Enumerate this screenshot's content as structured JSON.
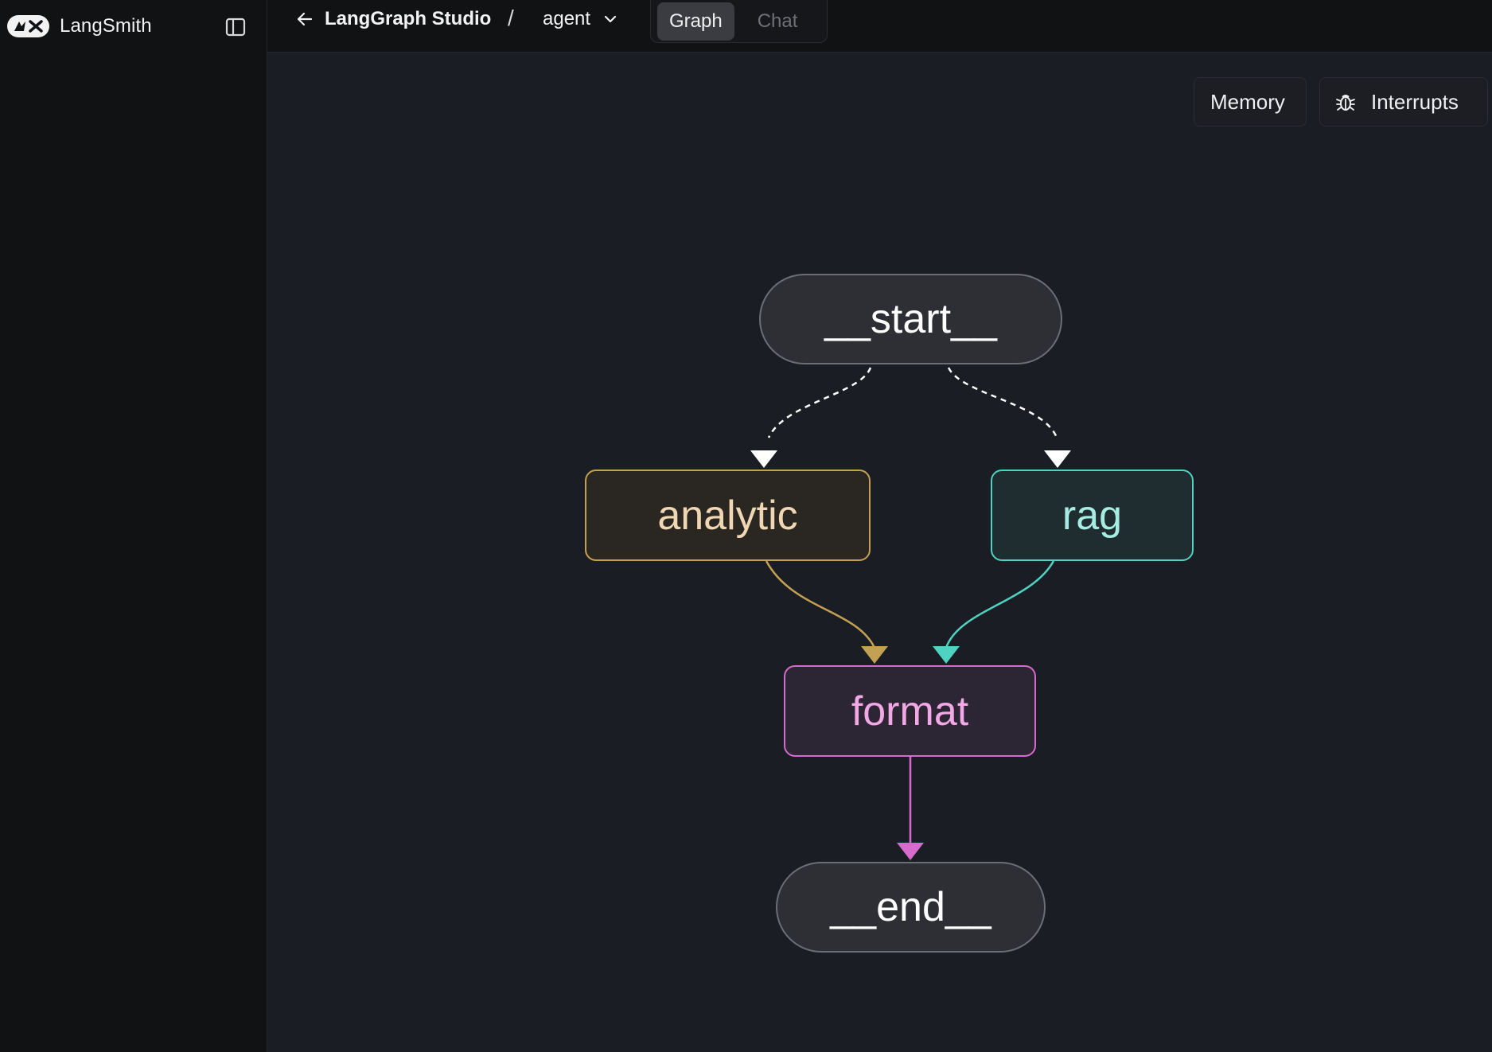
{
  "sidebar": {
    "brand_name": "LangSmith",
    "brand_logo_icon": "langsmith-logo-icon",
    "toggle_icon": "sidebar-toggle-icon"
  },
  "topbar": {
    "back_label": "LangGraph Studio",
    "breadcrumb_separator": "/",
    "graph_name": "agent",
    "tabs": [
      {
        "label": "Graph",
        "active": true
      },
      {
        "label": "Chat",
        "active": false
      }
    ]
  },
  "canvas": {
    "memory_label": "Memory",
    "interrupts_label": "Interrupts",
    "interrupts_icon": "bug-icon"
  },
  "graph": {
    "nodes": [
      {
        "id": "start",
        "label": "__start__"
      },
      {
        "id": "analytic",
        "label": "analytic",
        "color": "#c4a053"
      },
      {
        "id": "rag",
        "label": "rag",
        "color": "#4fd2c1"
      },
      {
        "id": "format",
        "label": "format",
        "color": "#d66bcd"
      },
      {
        "id": "end",
        "label": "__end__"
      }
    ],
    "edges": [
      {
        "from": "start",
        "to": "analytic",
        "style": "dashed",
        "color": "#ffffff"
      },
      {
        "from": "start",
        "to": "rag",
        "style": "dashed",
        "color": "#ffffff"
      },
      {
        "from": "analytic",
        "to": "format",
        "style": "solid",
        "color": "#c4a053"
      },
      {
        "from": "rag",
        "to": "format",
        "style": "solid",
        "color": "#4fd2c1"
      },
      {
        "from": "format",
        "to": "end",
        "style": "solid",
        "color": "#d66bcd"
      }
    ]
  }
}
